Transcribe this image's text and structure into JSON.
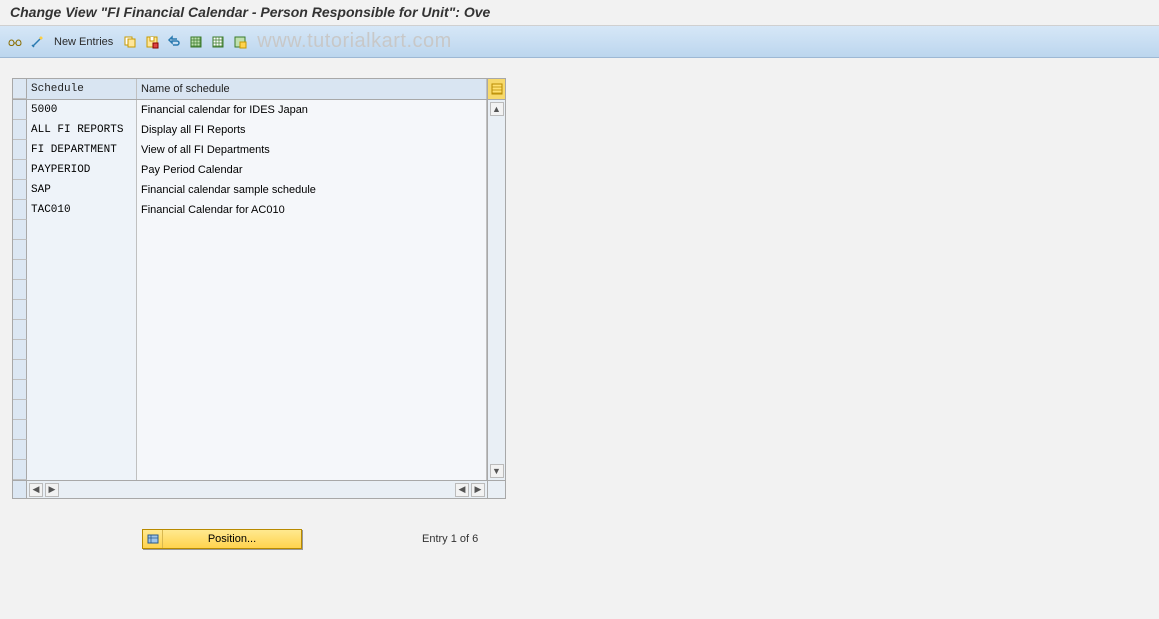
{
  "title": "Change View \"FI Financial Calendar - Person Responsible for Unit\": Ove",
  "toolbar": {
    "new_entries_label": "New Entries"
  },
  "watermark": "www.tutorialkart.com",
  "table": {
    "headers": {
      "schedule": "Schedule",
      "name": "Name of schedule"
    },
    "rows": [
      {
        "schedule": "5000",
        "name": "Financial calendar for IDES Japan"
      },
      {
        "schedule": "ALL FI REPORTS",
        "name": "Display all FI Reports"
      },
      {
        "schedule": "FI DEPARTMENT",
        "name": "View of all FI Departments"
      },
      {
        "schedule": "PAYPERIOD",
        "name": "Pay Period Calendar"
      },
      {
        "schedule": "SAP",
        "name": "Financial calendar sample schedule"
      },
      {
        "schedule": "TAC010",
        "name": "Financial Calendar for AC010"
      }
    ],
    "empty_row_count": 13
  },
  "footer": {
    "position_label": "Position...",
    "entry_text": "Entry 1 of 6"
  },
  "icons": {
    "glasses": "glasses-icon",
    "wand": "wand-icon",
    "copy": "copy-icon",
    "save_variant": "save-variant-icon",
    "undo": "undo-icon",
    "table1": "select-all-icon",
    "table2": "deselect-all-icon",
    "config": "configure-icon"
  }
}
